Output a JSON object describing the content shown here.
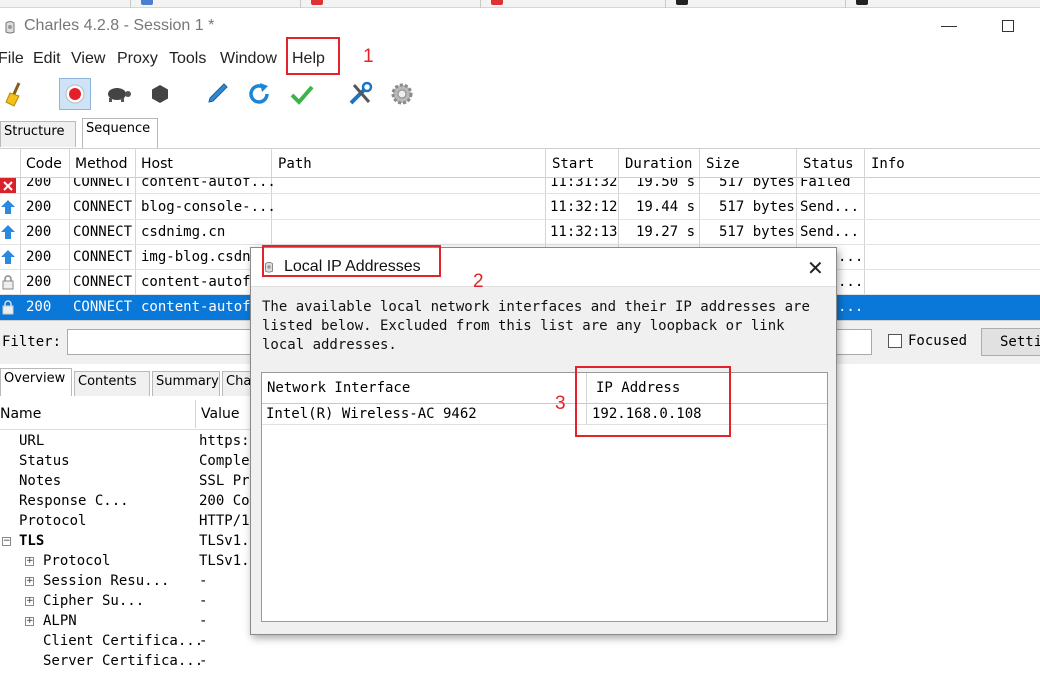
{
  "window": {
    "title": "Charles 4.2.8 - Session 1 *"
  },
  "menu": {
    "items": [
      "File",
      "Edit",
      "View",
      "Proxy",
      "Tools",
      "Window",
      "Help"
    ]
  },
  "toolbar": {
    "icons": [
      "broom-icon",
      "record-icon",
      "turtle-icon",
      "hexagon-stop-icon",
      "pen-icon",
      "refresh-icon",
      "checkmark-icon",
      "tools-icon",
      "gear-icon"
    ]
  },
  "annotations": {
    "one": "1",
    "two": "2",
    "three": "3"
  },
  "view_tabs": {
    "structure": "Structure",
    "sequence": "Sequence"
  },
  "sequence_table": {
    "headers": [
      "Code",
      "Method",
      "Host",
      "Path",
      "Start",
      "Duration",
      "Size",
      "Status",
      "Info"
    ],
    "rows": [
      {
        "code": "200",
        "method": "CONNECT",
        "host": "content-autof...",
        "start": "11:31:32",
        "duration": "19.50 s",
        "size": "517 bytes",
        "status": "Failed",
        "icon": "error-x-icon"
      },
      {
        "code": "200",
        "method": "CONNECT",
        "host": "blog-console-...",
        "start": "11:32:12",
        "duration": "19.44 s",
        "size": "517 bytes",
        "status": "Send...",
        "icon": "upload-arrow-icon"
      },
      {
        "code": "200",
        "method": "CONNECT",
        "host": "csdnimg.cn",
        "start": "11:32:13",
        "duration": "19.27 s",
        "size": "517 bytes",
        "status": "Send...",
        "icon": "upload-arrow-icon"
      },
      {
        "code": "200",
        "method": "CONNECT",
        "host": "img-blog.csdn...",
        "start": "",
        "duration": "",
        "size": "",
        "status": "...",
        "icon": "upload-arrow-icon"
      },
      {
        "code": "200",
        "method": "CONNECT",
        "host": "content-autof...",
        "start": "",
        "duration": "",
        "size": "",
        "status": "...",
        "icon": "lock-icon"
      },
      {
        "code": "200",
        "method": "CONNECT",
        "host": "content-autof...",
        "start": "",
        "duration": "",
        "size": "",
        "status": "...",
        "icon": "lock-icon"
      }
    ]
  },
  "filter": {
    "label": "Filter:",
    "value": "",
    "focused_label": "Focused",
    "settings_label": "Setti"
  },
  "lower_tabs": [
    "Overview",
    "Contents",
    "Summary",
    "Cha"
  ],
  "overview": {
    "headers": {
      "name": "Name",
      "value": "Value"
    },
    "rows": [
      {
        "name": "URL",
        "value": "https:"
      },
      {
        "name": "Status",
        "value": "Comple"
      },
      {
        "name": "Notes",
        "value": "SSL Pr"
      },
      {
        "name": "Response C...",
        "value": "200 Cor"
      },
      {
        "name": "Protocol",
        "value": "HTTP/1"
      },
      {
        "name": "TLS",
        "value": "TLSv1."
      },
      {
        "name": "Protocol",
        "value": "TLSv1."
      },
      {
        "name": "Session Resu...",
        "value": "-"
      },
      {
        "name": "Cipher Su...",
        "value": "-"
      },
      {
        "name": "ALPN",
        "value": "-"
      },
      {
        "name": "Client Certifica...",
        "value": "-"
      },
      {
        "name": "Server Certifica...",
        "value": "-"
      }
    ]
  },
  "dialog": {
    "title": "Local IP Addresses",
    "description": "The available local network interfaces and their IP addresses are listed below.  Excluded from this list are any loopback or link local addresses.",
    "columns": {
      "interface": "Network Interface",
      "ip": "IP Address"
    },
    "rows": [
      {
        "interface": "Intel(R) Wireless-AC 9462",
        "ip": "192.168.0.108"
      }
    ]
  },
  "colors": {
    "selection": "#0a78d8",
    "annotation_red": "#e2232a"
  }
}
